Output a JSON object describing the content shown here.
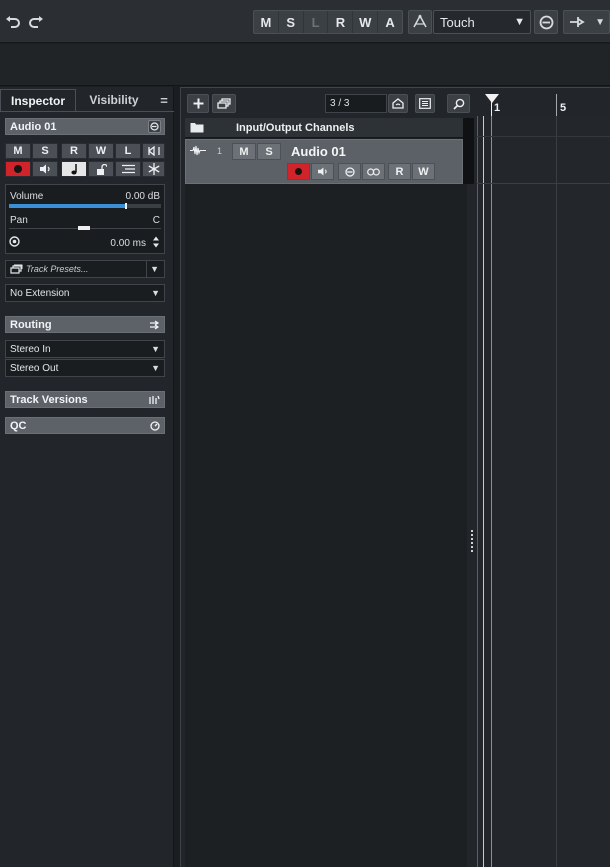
{
  "toolbar": {
    "undo_icon": "undo-icon",
    "redo_icon": "redo-icon",
    "automation_buttons": [
      {
        "label": "M",
        "dim": false
      },
      {
        "label": "S",
        "dim": false
      },
      {
        "label": "L",
        "dim": true
      },
      {
        "label": "R",
        "dim": false
      },
      {
        "label": "W",
        "dim": false
      },
      {
        "label": "A",
        "dim": false
      }
    ],
    "automation_mode": "Touch"
  },
  "left_zone": {
    "tabs": {
      "inspector": "Inspector",
      "visibility": "Visibility"
    },
    "menu_glyph": "="
  },
  "inspector": {
    "track_name": "Audio 01",
    "row1": [
      "M",
      "S",
      "R",
      "W",
      "L"
    ],
    "volume_label": "Volume",
    "volume_value": "0.00 dB",
    "pan_label": "Pan",
    "pan_value": "C",
    "delay_value": "0.00 ms",
    "track_presets_placeholder": "Track Presets...",
    "extension": "No Extension",
    "routing_title": "Routing",
    "routing_in": "Stereo In",
    "routing_out": "Stereo Out",
    "track_versions_title": "Track Versions",
    "qc_title": "QC"
  },
  "project": {
    "track_count": "3 / 3",
    "folder_track_name": "Input/Output Channels",
    "audio_track": {
      "number": "1",
      "mute": "M",
      "solo": "S",
      "name": "Audio 01",
      "read": "R",
      "write": "W"
    },
    "ruler_marks": [
      "1",
      "5"
    ]
  },
  "colors": {
    "record_active": "#d0232a",
    "monitor_active": "#e6e6e6",
    "volume_fader": "#3a8fd6"
  }
}
